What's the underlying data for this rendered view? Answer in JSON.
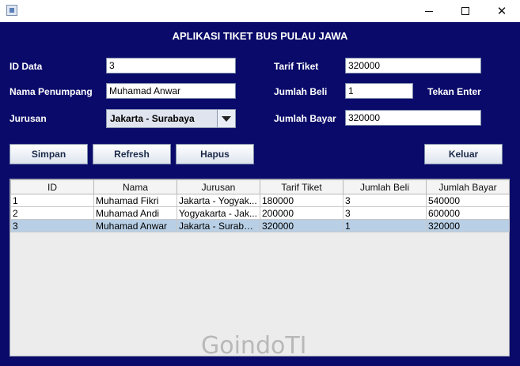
{
  "window": {
    "title": "",
    "minimize_icon": "minimize-icon",
    "maximize_icon": "maximize-icon",
    "close_icon": "close-icon",
    "close_glyph": "✕"
  },
  "header": {
    "title": "APLIKASI TIKET BUS PULAU JAWA"
  },
  "form": {
    "id_label": "ID Data",
    "id_value": "3",
    "nama_label": "Nama Penumpang",
    "nama_value": "Muhamad Anwar",
    "jurusan_label": "Jurusan",
    "jurusan_value": "Jakarta - Surabaya",
    "tarif_label": "Tarif Tiket",
    "tarif_value": "320000",
    "jumlah_beli_label": "Jumlah Beli",
    "jumlah_beli_value": "1",
    "hint_label": "Tekan Enter",
    "jumlah_bayar_label": "Jumlah Bayar",
    "jumlah_bayar_value": "320000"
  },
  "buttons": {
    "simpan": "Simpan",
    "refresh": "Refresh",
    "hapus": "Hapus",
    "keluar": "Keluar"
  },
  "table": {
    "columns": [
      "ID",
      "Nama",
      "Jurusan",
      "Tarif Tiket",
      "Jumlah Beli",
      "Jumlah Bayar"
    ],
    "rows": [
      [
        "1",
        "Muhamad Fikri",
        "Jakarta - Yogyak...",
        "180000",
        "3",
        "540000"
      ],
      [
        "2",
        "Muhamad Andi",
        "Yogyakarta - Jak...",
        "200000",
        "3",
        "600000"
      ],
      [
        "3",
        "Muhamad Anwar",
        "Jakarta - Surabaya",
        "320000",
        "1",
        "320000"
      ]
    ],
    "selected_row_index": 2
  },
  "watermark": "GoindoTI",
  "colors": {
    "panel_bg": "#0a0a6a",
    "selected_row": "#b8cfe5"
  }
}
